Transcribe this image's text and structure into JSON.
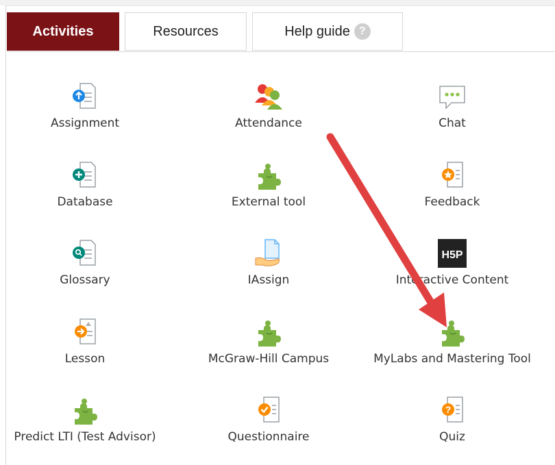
{
  "tabs": [
    {
      "label": "Activities",
      "active": true
    },
    {
      "label": "Resources",
      "active": false
    },
    {
      "label": "Help guide",
      "active": false
    }
  ],
  "help_icon_glyph": "?",
  "items": [
    {
      "label": "Assignment",
      "icon": "assignment-icon"
    },
    {
      "label": "Attendance",
      "icon": "attendance-icon"
    },
    {
      "label": "Chat",
      "icon": "chat-icon"
    },
    {
      "label": "Database",
      "icon": "database-icon"
    },
    {
      "label": "External tool",
      "icon": "puzzle-icon"
    },
    {
      "label": "Feedback",
      "icon": "feedback-icon"
    },
    {
      "label": "Glossary",
      "icon": "glossary-icon"
    },
    {
      "label": "IAssign",
      "icon": "iassign-icon"
    },
    {
      "label": "Interactive Content",
      "icon": "h5p-icon",
      "icon_text": "H5P"
    },
    {
      "label": "Lesson",
      "icon": "lesson-icon"
    },
    {
      "label": "McGraw-Hill Campus",
      "icon": "puzzle-icon"
    },
    {
      "label": "MyLabs and Mastering Tool",
      "icon": "puzzle-icon"
    },
    {
      "label": "Predict LTI (Test Advisor)",
      "icon": "puzzle-icon"
    },
    {
      "label": "Questionnaire",
      "icon": "questionnaire-icon"
    },
    {
      "label": "Quiz",
      "icon": "quiz-icon"
    }
  ],
  "colors": {
    "active_tab": "#7a1216",
    "arrow": "#e04040",
    "puzzle": "#7cb342"
  }
}
